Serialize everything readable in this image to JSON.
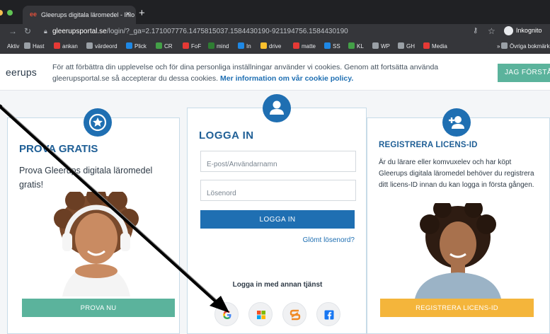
{
  "browser": {
    "tab_title": "Gleerups digitala läromedel - Inlo",
    "tab_close": "×",
    "favicon_text": "ee",
    "new_tab": "+",
    "url_host": "gleerupsportal.se",
    "url_path": "/login/?_ga=2.171007776.1475815037.1584430190-921194756.1584430190",
    "profile_label": "Inkognito",
    "bookmarks": [
      {
        "label": "Aktiv",
        "color": "#35363a"
      },
      {
        "label": "Hast",
        "color": "#9aa0a6"
      },
      {
        "label": "ankan",
        "color": "#e53935"
      },
      {
        "label": "värdeord",
        "color": "#9aa0a6"
      },
      {
        "label": "Plick",
        "color": "#1e88e5"
      },
      {
        "label": "CR",
        "color": "#43a047"
      },
      {
        "label": "FoF",
        "color": "#e53935"
      },
      {
        "label": "mind",
        "color": "#2e7d32"
      },
      {
        "label": "In",
        "color": "#1e88e5"
      },
      {
        "label": "drive",
        "color": "#fbc02d"
      },
      {
        "label": "matte",
        "color": "#e53935"
      },
      {
        "label": "SS",
        "color": "#1e88e5"
      },
      {
        "label": "KL",
        "color": "#43a047"
      },
      {
        "label": "WP",
        "color": "#9aa0a6"
      },
      {
        "label": "GH",
        "color": "#9aa0a6"
      },
      {
        "label": "Media",
        "color": "#e53935"
      },
      {
        "label": "»",
        "color": "#35363a"
      },
      {
        "label": "Övriga bokmärken",
        "color": "#9aa0a6"
      }
    ]
  },
  "cookie": {
    "logo": "eerups",
    "text": "För att förbättra din upplevelse och för dina personliga inställningar använder vi cookies. Genom att fortsätta använda gleerupsportal.se så accepterar du dessa cookies.",
    "link": "Mer information om vår cookie policy.",
    "accept": "JAG FÖRSTÅR"
  },
  "free": {
    "title": "PROVA GRATIS",
    "text": "Prova Gleerups digitala läromedel gratis!",
    "button": "PROVA NU"
  },
  "login": {
    "title": "LOGGA IN",
    "email_placeholder": "E-post/Användarnamn",
    "password_placeholder": "Lösenord",
    "button": "LOGGA IN",
    "forgot": "Glömt lösenord?",
    "other": "Logga in med annan tjänst",
    "social": [
      "google-icon",
      "microsoft-icon",
      "skolon-icon",
      "facebook-icon"
    ]
  },
  "register": {
    "title": "REGISTRERA LICENS-ID",
    "text": "Är du lärare eller komvuxelev och har köpt Gleerups digitala läromedel behöver du registrera ditt licens-ID innan du kan logga in första gången.",
    "button": "REGISTRERA LICENS-ID"
  },
  "colors": {
    "brand_blue": "#1f6fb2",
    "green": "#5bb39c",
    "yellow": "#f4b53b"
  }
}
